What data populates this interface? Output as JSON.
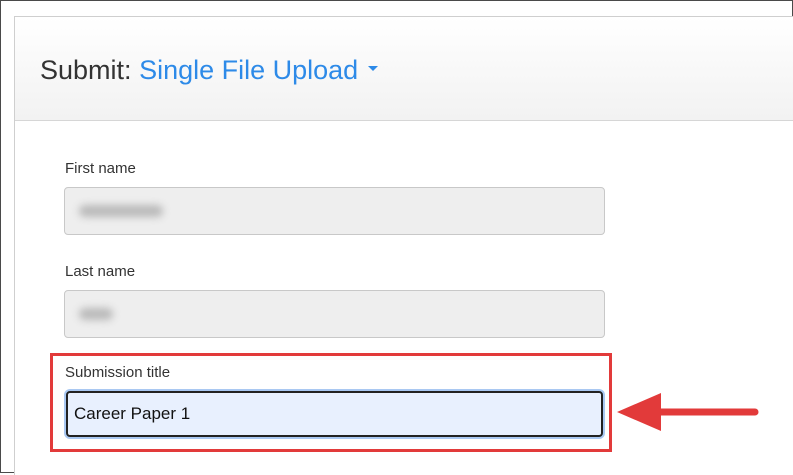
{
  "header": {
    "prefix": "Submit:",
    "mode_label": "Single File Upload"
  },
  "fields": {
    "first_name": {
      "label": "First name"
    },
    "last_name": {
      "label": "Last name"
    },
    "submission_title": {
      "label": "Submission title",
      "value": "Career Paper 1"
    }
  },
  "annotation": {
    "highlight_color": "#e23a3a",
    "arrow_color": "#e23a3a"
  },
  "colors": {
    "link": "#2d8ae8",
    "text": "#333333"
  }
}
